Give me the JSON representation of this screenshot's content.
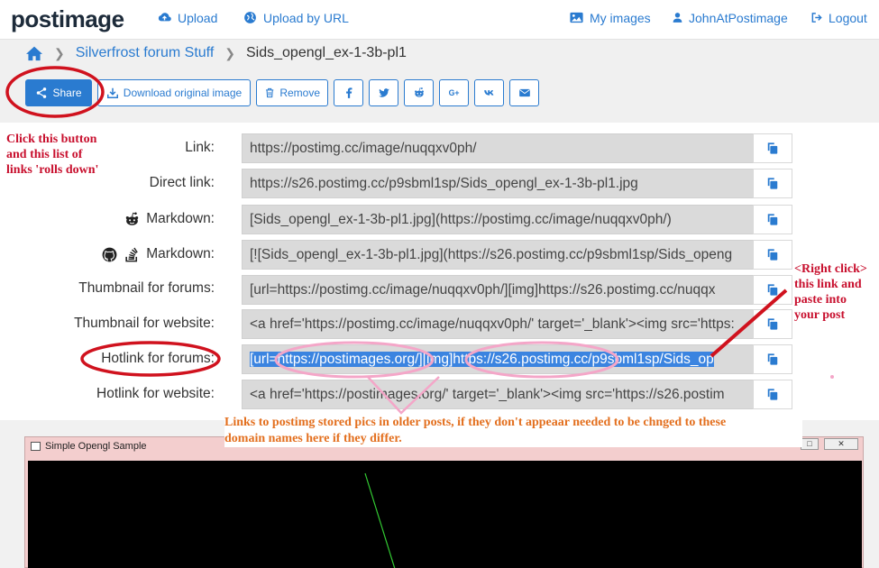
{
  "nav": {
    "logo": "postimage",
    "upload": "Upload",
    "upload_url": "Upload by URL",
    "my_images": "My images",
    "user": "JohnAtPostimage",
    "logout": "Logout"
  },
  "breadcrumb": {
    "folder": "Silverfrost forum Stuff",
    "current": "Sids_opengl_ex-1-3b-pl1"
  },
  "toolbar": {
    "share": "Share",
    "download": "Download original image",
    "remove": "Remove",
    "social_icons": [
      "facebook-icon",
      "twitter-icon",
      "reddit-icon",
      "google-plus-icon",
      "vk-icon",
      "email-icon"
    ]
  },
  "links": [
    {
      "label": "Link:",
      "value": "https://postimg.cc/image/nuqqxv0ph/"
    },
    {
      "label": "Direct link:",
      "value": "https://s26.postimg.cc/p9sbml1sp/Sids_opengl_ex-1-3b-pl1.jpg"
    },
    {
      "label": "Markdown:",
      "value": "[Sids_opengl_ex-1-3b-pl1.jpg](https://postimg.cc/image/nuqqxv0ph/)"
    },
    {
      "label": "Markdown:",
      "value": "[![Sids_opengl_ex-1-3b-pl1.jpg](https://s26.postimg.cc/p9sbml1sp/Sids_openg"
    },
    {
      "label": "Thumbnail for forums:",
      "value": "[url=https://postimg.cc/image/nuqqxv0ph/][img]https://s26.postimg.cc/nuqqx"
    },
    {
      "label": "Thumbnail for website:",
      "value": "<a href='https://postimg.cc/image/nuqqxv0ph/' target='_blank'><img src='https:"
    },
    {
      "label": "Hotlink for forums:",
      "value": "[url=https://postimages.org/][img]https://s26.postimg.cc/p9sbml1sp/Sids_op"
    },
    {
      "label": "Hotlink for website:",
      "value": "<a href='https://postimages.org/' target='_blank'><img src='https://s26.postim"
    }
  ],
  "preview": {
    "window_title": "Simple Opengl Sample"
  },
  "annotations": {
    "share_note": [
      "Click this button",
      "and this list of",
      "links 'rolls down'"
    ],
    "right_click_note": [
      "<Right click>",
      "this link and",
      "paste into",
      "your post"
    ],
    "domain_note": [
      "Links to postimg stored pics in older posts, if they don't appeaar needed to be chnged to these",
      "domain names here if they differ."
    ]
  },
  "colors": {
    "accent": "#2a7bd0",
    "annotation_red": "#c8102e",
    "annotation_orange": "#e36f1e",
    "annotation_pink": "#f4a6c8",
    "selection": "#3b84e0"
  }
}
